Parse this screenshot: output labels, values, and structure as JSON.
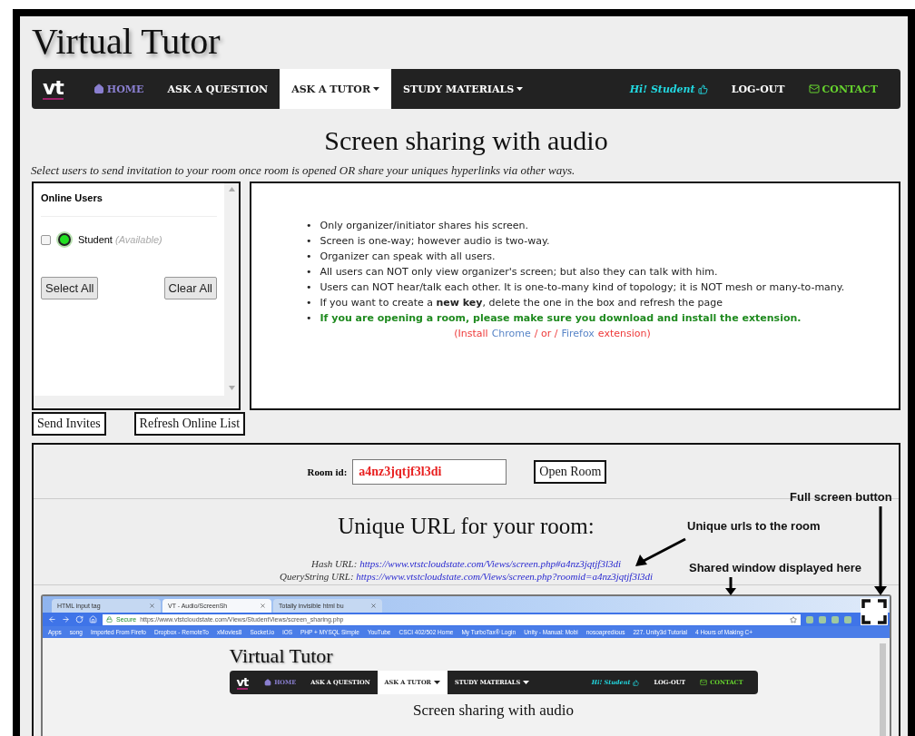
{
  "site_title": "Virtual Tutor",
  "nav": {
    "logo": "vt",
    "items": [
      {
        "label": "HOME",
        "kind": "home",
        "selected": false
      },
      {
        "label": "ASK A QUESTION",
        "kind": "plain",
        "selected": false
      },
      {
        "label": "ASK A TUTOR",
        "kind": "dropdown",
        "selected": true
      },
      {
        "label": "STUDY MATERIALS",
        "kind": "dropdown",
        "selected": false
      }
    ],
    "right": [
      {
        "label": "Hi! Student",
        "kind": "greeting"
      },
      {
        "label": "LOG-OUT",
        "kind": "plain"
      },
      {
        "label": "CONTACT",
        "kind": "contact"
      }
    ]
  },
  "heading": "Screen sharing with audio",
  "subtitle": "Select users to send invitation to your room once room is opened OR share your uniques hyperlinks via other ways.",
  "online_users": {
    "title": "Online Users",
    "users": [
      {
        "name": "Student",
        "status": "(Available)",
        "checked": false,
        "color": "#22e022"
      }
    ],
    "buttons": [
      "Select All",
      "Clear All"
    ]
  },
  "actions": [
    "Send Invites",
    "Refresh Online List"
  ],
  "info": {
    "items": [
      {
        "text": "Only organizer/initiator shares his screen.",
        "kind": "normal"
      },
      {
        "text": "Screen is one-way; however audio is two-way.",
        "kind": "normal"
      },
      {
        "text": "Organizer can speak with all users.",
        "kind": "normal"
      },
      {
        "text": "All users can NOT only view organizer's screen; but also they can talk with him.",
        "kind": "normal"
      },
      {
        "text": "Users can NOT hear/talk each other. It is one-to-many kind of topology; it is NOT mesh or many-to-many.",
        "kind": "normal"
      },
      {
        "text": "If you want to create a **new key**, delete the one in the box and refresh the page",
        "kind": "normal"
      },
      {
        "text": "**If you are opening a room, please make sure you download and install the extension.**",
        "kind": "warning"
      }
    ],
    "marker": "•",
    "install": [
      {
        "text": "(Install",
        "kind": "text"
      },
      {
        "text": "Chrome",
        "kind": "link"
      },
      {
        "text": "/ or /",
        "kind": "text"
      },
      {
        "text": "Firefox",
        "kind": "link"
      },
      {
        "text": "extension)",
        "kind": "text"
      }
    ]
  },
  "room": {
    "label": "Room id:",
    "value": "a4nz3jqtjf3l3di",
    "button": "Open Room"
  },
  "urls": {
    "heading": "Unique URL for your room:",
    "items": [
      {
        "label": "Hash URL:",
        "url": "https://www.vtstcloudstate.com/Views/screen.php#a4nz3jqtjf3l3di"
      },
      {
        "label": "QueryString URL:",
        "url": "https://www.vtstcloudstate.com/Views/screen.php?roomid=a4nz3jqtjf3l3di"
      }
    ]
  },
  "annotations": {
    "full_screen": "Full screen button",
    "unique_urls": "Unique urls to the room",
    "shared_window": "Shared window displayed here"
  },
  "shared_window": {
    "tabs": [
      {
        "label": "HTML input tag",
        "selected": false
      },
      {
        "label": "VT - Audio/ScreenSh",
        "selected": true
      },
      {
        "label": "Totally invisible html bu",
        "selected": false
      }
    ],
    "secure": "Secure",
    "address": "https://www.vtstcloudstate.com/Views/StudentViews/screen_sharing.php",
    "bookmarks": [
      "Apps",
      "song",
      "Imported From Firefo",
      "Dropbox - RemoteTo",
      "xMovies8",
      "Socket.io",
      "iOS",
      "PHP + MYSQL Simple",
      "YouTube",
      "CSCI 402/502 Home",
      "My TurboTax® Login",
      "Unity - Manual: Mobi",
      "nosoapredious",
      "227. Unity3d Tutorial",
      "4 Hours of Making C+"
    ],
    "page": {
      "site_title": "Virtual Tutor",
      "nav": {
        "logo": "vt",
        "items": [
          {
            "label": "HOME",
            "kind": "home",
            "selected": false
          },
          {
            "label": "ASK A QUESTION",
            "kind": "plain",
            "selected": false
          },
          {
            "label": "ASK A TUTOR",
            "kind": "dropdown",
            "selected": true
          },
          {
            "label": "STUDY MATERIALS",
            "kind": "dropdown",
            "selected": false
          }
        ],
        "right": [
          {
            "label": "Hi! Student",
            "kind": "greeting"
          },
          {
            "label": "LOG-OUT",
            "kind": "plain"
          },
          {
            "label": "CONTACT",
            "kind": "contact"
          }
        ]
      },
      "heading": "Screen sharing with audio"
    }
  }
}
